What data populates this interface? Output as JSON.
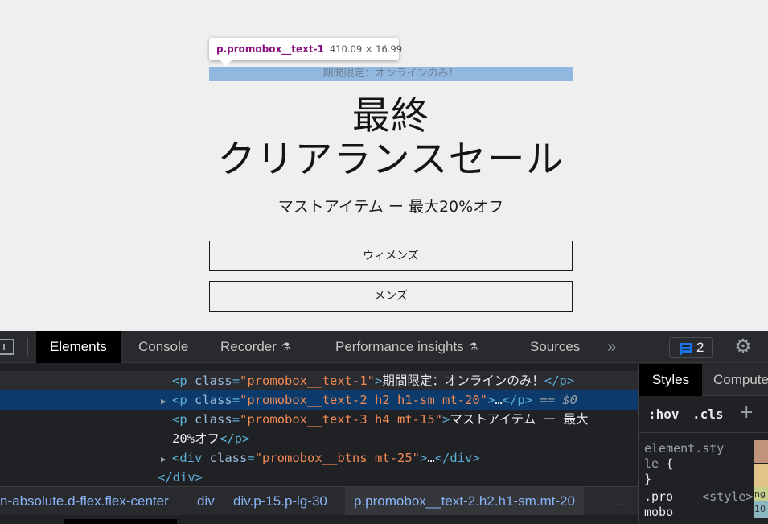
{
  "page": {
    "tooltip": {
      "selector": "p.promobox__text-1",
      "size": "410.09 × 16.99"
    },
    "text1": "期間限定：オンラインのみ！",
    "heading_line1": "最終",
    "heading_line2": "クリアランスセール",
    "text3": "マストアイテム ー 最大20%オフ",
    "buttons": [
      "ウィメンズ",
      "メンズ"
    ]
  },
  "devtools": {
    "tabs": [
      "Elements",
      "Console",
      "Recorder",
      "Performance insights",
      "Sources"
    ],
    "more_tabs": "»",
    "issues_count": "2",
    "dom_lines": [
      {
        "indent": "  ",
        "open": "<p",
        "attr": "class",
        "eq": "=",
        "value": "\"promobox__text-1\"",
        "close": ">",
        "text": "期間限定：オンラインのみ！",
        "end": "</p>"
      },
      {
        "triangle": "▶",
        "open": "<p",
        "attr": "class",
        "eq": "=",
        "value": "\"promobox__text-2 h2 h1-sm mt-20\"",
        "close": ">",
        "text": "…",
        "end": "</p>",
        "marker": "== $0"
      },
      {
        "open": "<p",
        "attr": "class",
        "eq": "=",
        "value": "\"promobox__text-3 h4 mt-15\"",
        "close": ">",
        "text": "マストアイテム ー 最大"
      },
      {
        "text": "20%オフ",
        "end": "</p>"
      },
      {
        "triangle": "▶",
        "open": "<div",
        "attr": "class",
        "eq": "=",
        "value": "\"promobox__btns mt-25\"",
        "close": ">",
        "text": "…",
        "end": "</div>"
      },
      {
        "end": "</div>"
      }
    ],
    "breadcrumbs": [
      "n-absolute.d-flex.flex-center",
      "div",
      "div.p-15.p-lg-30",
      "p.promobox__text-2.h2.h1-sm.mt-20"
    ],
    "breadcrumb_more": "…",
    "styles_tabs": [
      "Styles",
      "Compute"
    ],
    "filter": {
      "hov": ":hov",
      "cls": ".cls",
      "add": "+"
    },
    "element_style": {
      "line1": "element.sty",
      "line2": "le",
      "brace_open": "{",
      "brace_close": "}"
    },
    "rule2": {
      "selector1": ".pro",
      "selector2": "mobo",
      "source": "<style>"
    },
    "box_model_labels": [
      "ng",
      "10"
    ]
  }
}
